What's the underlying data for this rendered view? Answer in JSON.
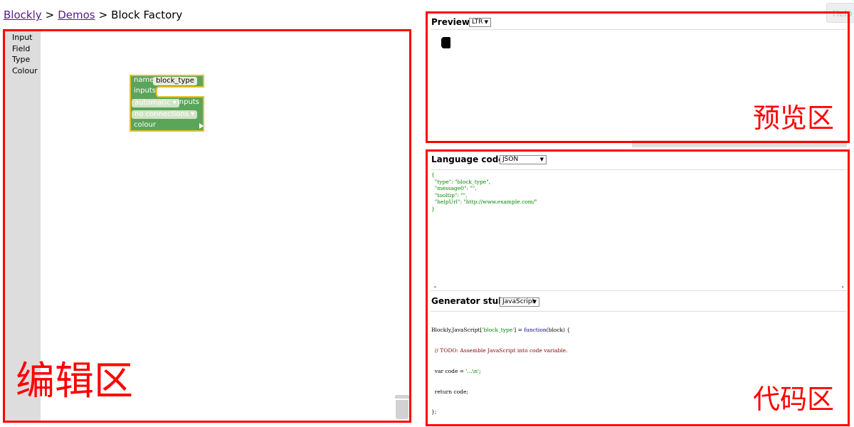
{
  "breadcrumb": {
    "items": [
      {
        "label": "Blockly",
        "link": true
      },
      {
        "label": "Demos",
        "link": true
      },
      {
        "label": "Block Factory",
        "link": false
      }
    ],
    "separator": ">"
  },
  "toolbox": {
    "categories": [
      "Input",
      "Field",
      "Type",
      "Colour"
    ]
  },
  "factory_block": {
    "name_label": "name",
    "name_value": "block_type",
    "inputs_label": "inputs",
    "automatic_value": "automatic",
    "automatic_suffix": "inputs",
    "connections_value": "no connections",
    "colour_label": "colour",
    "block_color": "#5ba55b",
    "outline_color": "#e4c12b"
  },
  "preview": {
    "title": "Preview:",
    "direction_value": "LTR",
    "help_label": "Help"
  },
  "language_code": {
    "title": "Language code:",
    "format_value": "JSON",
    "lines": [
      "{",
      "  \"type\": \"block_type\",",
      "  \"message0\": \"\",",
      "  \"tooltip\": \"\",",
      "  \"helpUrl\": \"http://www.example.com/\"",
      "}"
    ]
  },
  "generator_stub": {
    "title": "Generator stub:",
    "language_value": "JavaScript",
    "line1_prefix": "Blockly.JavaScript[",
    "line1_key": "'block_type'",
    "line1_mid": "] = ",
    "line1_fn": "function",
    "line1_suffix": "(block) {",
    "line2": "  // TODO: Assemble JavaScript into code variable.",
    "line3_prefix": "  var code = ",
    "line3_str": "'...\\n'",
    "line3_suffix": ";",
    "line4": "  return code;",
    "line5": "};"
  },
  "annotations": {
    "editor_label": "编辑区",
    "preview_label": "预览区",
    "code_label": "代码区",
    "color": "#ff0000"
  }
}
